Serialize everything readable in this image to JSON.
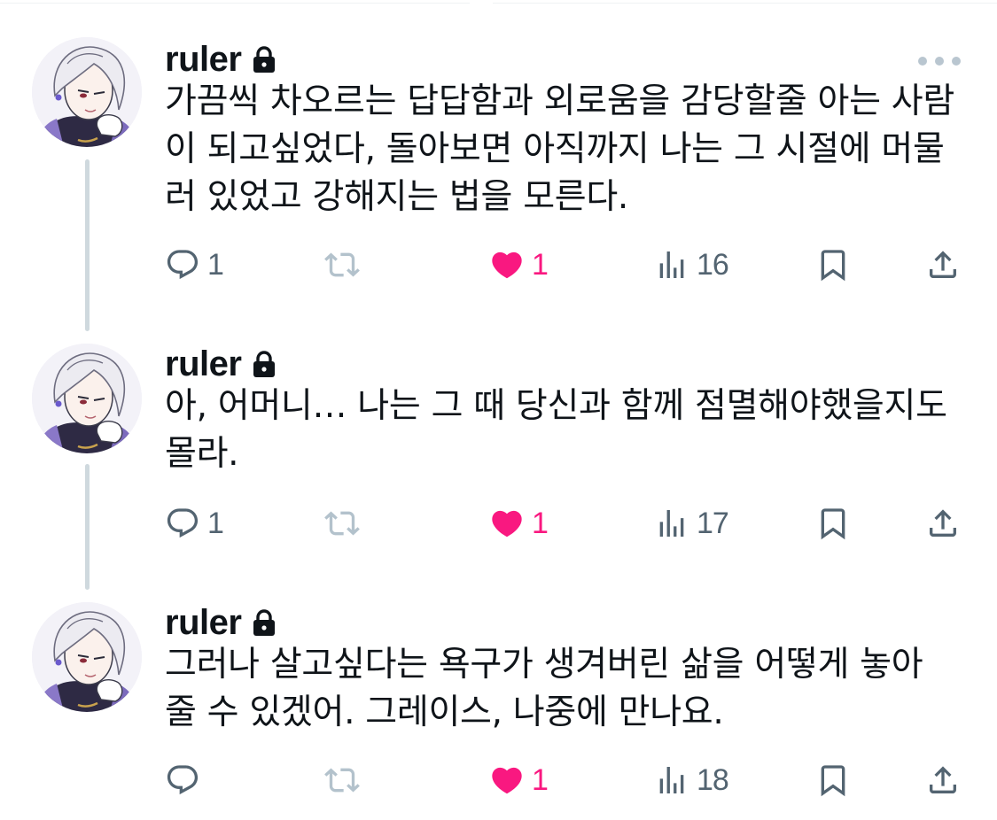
{
  "thread": {
    "author": "ruler",
    "locked": true,
    "tweets": [
      {
        "lines": [
          "가끔씩 차오르는 답답함과 외로움을 감당할줄 아는 사람",
          "이 되고싶었다, 돌아보면 아직까지 나는 그 시절에 머물",
          "러 있었고 강해지는 법을 모른다."
        ],
        "replies": "1",
        "retweets": "",
        "likes": "1",
        "views": "16"
      },
      {
        "lines": [
          "아, 어머니… 나는 그 때 당신과 함께 점멸해야했을지도",
          "몰라."
        ],
        "replies": "1",
        "retweets": "",
        "likes": "1",
        "views": "17"
      },
      {
        "lines": [
          "그러나 살고싶다는 욕구가 생겨버린 삶을 어떻게 놓아",
          "줄 수 있겠어. 그레이스, 나중에 만나요."
        ],
        "replies": "",
        "retweets": "",
        "likes": "1",
        "views": "18"
      }
    ]
  },
  "colors": {
    "text": "#0f1419",
    "secondary": "#536471",
    "like": "#f91880",
    "thread_line": "#cfd9de",
    "retweet_icon": "#b3c2cc"
  },
  "icons": [
    "lock-icon",
    "more-icon",
    "reply-icon",
    "retweet-icon",
    "heart-icon",
    "views-icon",
    "bookmark-icon",
    "share-icon"
  ]
}
